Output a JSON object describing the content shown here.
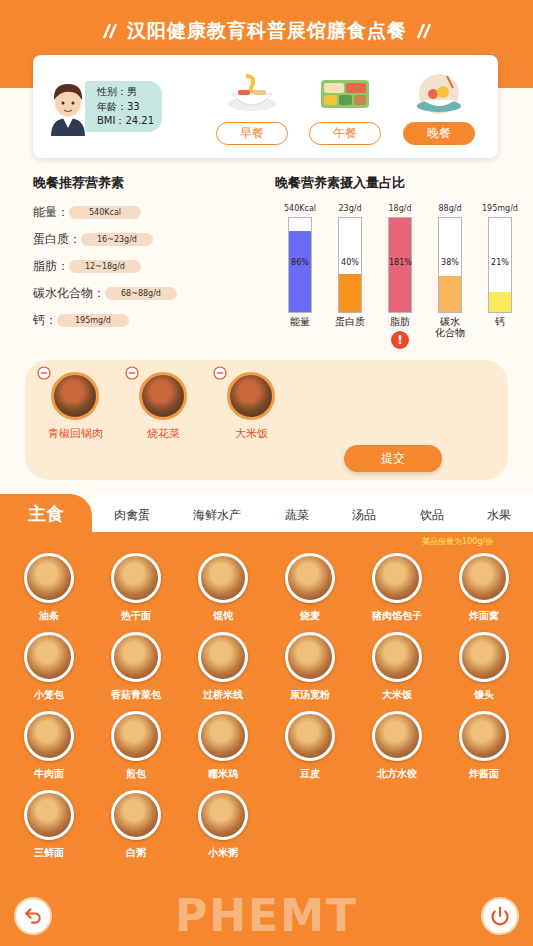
{
  "header": {
    "title": "汉阳健康教育科普展馆膳食点餐"
  },
  "profile": {
    "fields": [
      {
        "label": "性别：",
        "value": "男"
      },
      {
        "label": "年龄：",
        "value": "33"
      },
      {
        "label": "BMI：",
        "value": "24.21"
      }
    ]
  },
  "meals": [
    {
      "label": "早餐",
      "selected": false
    },
    {
      "label": "午餐",
      "selected": false
    },
    {
      "label": "晚餐",
      "selected": true
    }
  ],
  "recommended": {
    "title": "晚餐推荐营养素",
    "items": [
      {
        "label": "能量：",
        "value": "540Kcal"
      },
      {
        "label": "蛋白质：",
        "value": "16~23g/d"
      },
      {
        "label": "脂肪：",
        "value": "12~18g/d"
      },
      {
        "label": "碳水化合物：",
        "value": "68~88g/d"
      },
      {
        "label": "钙：",
        "value": "195mg/d"
      }
    ]
  },
  "chart": {
    "title": "晚餐营养素摄入量占比",
    "values": [
      86,
      40,
      181,
      38,
      21
    ],
    "alert_mark": "!",
    "bars": [
      {
        "label": "能量",
        "target": "540Kcal",
        "reading": "86%",
        "color": "#6b6cf5",
        "alert": false
      },
      {
        "label": "蛋白质",
        "target": "23g/d",
        "reading": "40%",
        "color": "#f7931e",
        "alert": false
      },
      {
        "label": "脂肪",
        "target": "18g/d",
        "reading": "181%",
        "color": "#ea6479",
        "alert": true
      },
      {
        "label": "碳水\n化合物",
        "target": "88g/d",
        "reading": "38%",
        "color": "#f9b55b",
        "alert": false
      },
      {
        "label": "钙",
        "target": "195mg/d",
        "reading": "21%",
        "color": "#fbea5c",
        "alert": false
      }
    ]
  },
  "selected_dishes": {
    "items": [
      "青椒回锅肉",
      "烧花菜",
      "大米饭"
    ],
    "submit": "提交"
  },
  "categories": [
    {
      "label": "主食",
      "selected": true
    },
    {
      "label": "肉禽蛋",
      "selected": false
    },
    {
      "label": "海鲜水产",
      "selected": false
    },
    {
      "label": "蔬菜",
      "selected": false
    },
    {
      "label": "汤品",
      "selected": false
    },
    {
      "label": "饮品",
      "selected": false
    },
    {
      "label": "水果",
      "selected": false
    }
  ],
  "portion_note": "菜品份量为100g/份",
  "foods": [
    "油条",
    "热干面",
    "馄饨",
    "烧麦",
    "猪肉馅包子",
    "炸面窝",
    "小笼包",
    "香菇青菜包",
    "过桥米线",
    "原汤宽粉",
    "大米饭",
    "馒头",
    "牛肉面",
    "煎包",
    "糯米鸡",
    "豆皮",
    "北方水饺",
    "炸酱面",
    "三鲜面",
    "白粥",
    "小米粥"
  ],
  "watermark": "PHEMT"
}
